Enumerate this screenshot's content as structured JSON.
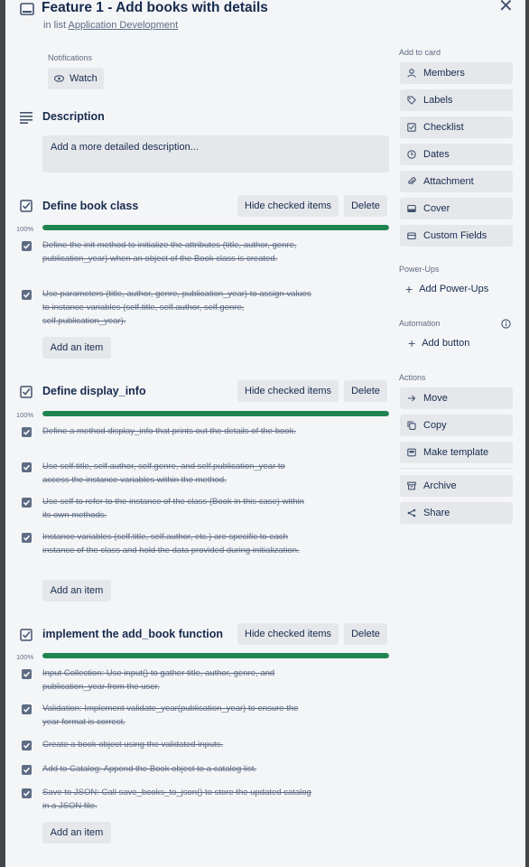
{
  "header": {
    "title": "Feature 1 - Add books with details",
    "in_list_prefix": "in list",
    "list_name": "Application Development"
  },
  "notifications": {
    "label": "Notifications",
    "watch_label": "Watch"
  },
  "description": {
    "heading": "Description",
    "placeholder": "Add a more detailed description..."
  },
  "checklists": [
    {
      "title": "Define book class",
      "hide_label": "Hide checked items",
      "delete_label": "Delete",
      "progress_text": "100%",
      "progress": 1.0,
      "items": [
        {
          "text": "Define the init method to initialize the attributes (title, author, genre, publication_year) when an object of the Book class is created.",
          "checked": true
        },
        {
          "text": "Use parameters (title, author, genre, publication_year) to assign values to instance variables (self.title, self.author, self.genre, self.publication_year).",
          "checked": true
        }
      ],
      "add_label": "Add an item"
    },
    {
      "title": "Define display_info",
      "hide_label": "Hide checked items",
      "delete_label": "Delete",
      "progress_text": "100%",
      "progress": 1.0,
      "items": [
        {
          "text": "Define a method display_info that prints out the details of the book.",
          "checked": true
        },
        {
          "text": "Use self.title, self.author, self.genre, and self.publication_year to access the instance variables within the method.",
          "checked": true
        },
        {
          "text": "Use self to refer to the instance of the class (Book in this case) within its own methods.",
          "checked": true
        },
        {
          "text": "Instance variables (self.title, self.author, etc.) are specific to each instance of the class and hold the data provided during initialization.",
          "checked": true
        }
      ],
      "add_label": "Add an item"
    },
    {
      "title": "implement the add_book function",
      "hide_label": "Hide checked items",
      "delete_label": "Delete",
      "progress_text": "100%",
      "progress": 1.0,
      "items": [
        {
          "text": "Input Collection: Use input() to gather title, author, genre, and publication_year from the user.",
          "checked": true
        },
        {
          "text": "Validation: Implement validate_year(publication_year) to ensure the year format is correct.",
          "checked": true
        },
        {
          "text": "Create a book object using the validated inputs.",
          "checked": true
        },
        {
          "text": "Add to Catalog: Append the Book object to a catalog list.",
          "checked": true
        },
        {
          "text": "Save to JSON: Call save_books_to_json() to store the updated catalog in a JSON file.",
          "checked": true
        }
      ],
      "add_label": "Add an item"
    }
  ],
  "sidebar": {
    "add_to_card_label": "Add to card",
    "add_to_card": [
      {
        "label": "Members",
        "icon": "person-icon"
      },
      {
        "label": "Labels",
        "icon": "tag-icon"
      },
      {
        "label": "Checklist",
        "icon": "checkbox-icon"
      },
      {
        "label": "Dates",
        "icon": "clock-icon"
      },
      {
        "label": "Attachment",
        "icon": "paperclip-icon"
      },
      {
        "label": "Cover",
        "icon": "cover-icon"
      },
      {
        "label": "Custom Fields",
        "icon": "fields-icon"
      }
    ],
    "powerups_label": "Power-Ups",
    "add_powerups_label": "Add Power-Ups",
    "automation_label": "Automation",
    "add_button_label": "Add button",
    "actions_label": "Actions",
    "actions": [
      {
        "label": "Move",
        "icon": "arrow-right-icon"
      },
      {
        "label": "Copy",
        "icon": "copy-icon"
      },
      {
        "label": "Make template",
        "icon": "template-icon"
      },
      {
        "label": "Archive",
        "icon": "archive-icon"
      },
      {
        "label": "Share",
        "icon": "share-icon"
      }
    ]
  },
  "colors": {
    "progress_complete": "#1f8450",
    "button_bg": "#e5e7eb",
    "card_bg": "#f4f5f7"
  }
}
